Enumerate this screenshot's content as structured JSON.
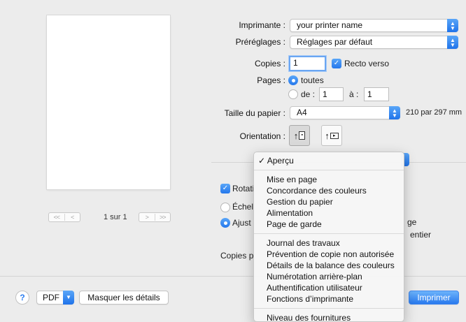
{
  "printer": {
    "label": "Imprimante :",
    "value": "your printer name"
  },
  "presets": {
    "label": "Préréglages :",
    "value": "Réglages par défaut"
  },
  "copies": {
    "label": "Copies :",
    "value": "1",
    "duplex_label": "Recto verso"
  },
  "pages": {
    "label": "Pages :",
    "all_label": "toutes",
    "from_label": "de :",
    "from_value": "1",
    "to_label": "à :",
    "to_value": "1"
  },
  "paper": {
    "label": "Taille du papier :",
    "value": "A4",
    "dimensions": "210 par 297 mm"
  },
  "orientation": {
    "label": "Orientation :",
    "portrait_glyph": "↑",
    "landscape_glyph": "↑"
  },
  "preview": {
    "page_count": "1 sur 1",
    "nav_first": "<<",
    "nav_prev": "<",
    "nav_next": ">",
    "nav_last": ">>"
  },
  "options": {
    "rotate_label": "Rotati",
    "scale_label": "Échel",
    "fit_label": "Ajust",
    "fit_suffix": "ge",
    "entire_label": "entier",
    "copies_per_label": "Copies p"
  },
  "menu": {
    "checked_item": "Aperçu",
    "group1": [
      "Mise en page",
      "Concordance des couleurs",
      "Gestion du papier",
      "Alimentation",
      "Page de garde"
    ],
    "group2": [
      "Journal des travaux",
      "Prévention de copie non autorisée",
      "Détails de la balance des couleurs",
      "Numérotation arrière-plan",
      "Authentification utilisateur",
      "Fonctions d’imprimante"
    ],
    "group3": [
      "Niveau des fournitures"
    ]
  },
  "footer": {
    "help": "?",
    "pdf": "PDF",
    "hide_details": "Masquer les détails",
    "print": "Imprimer"
  },
  "colors": {
    "accent": "#2a7cf0",
    "background": "#ececec"
  }
}
